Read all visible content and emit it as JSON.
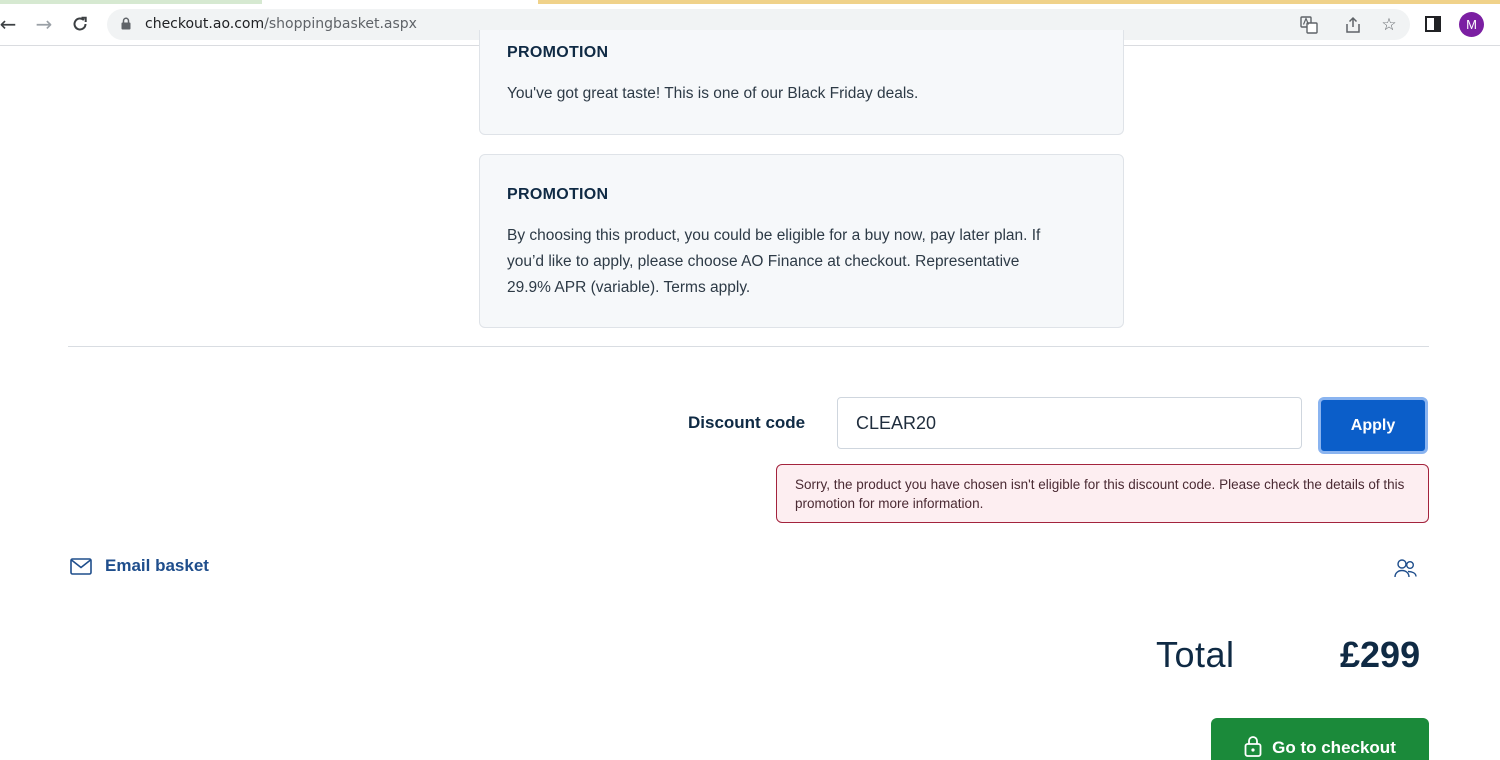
{
  "browser": {
    "url_host": "checkout.ao.com",
    "url_path": "/shoppingbasket.aspx",
    "profile_initial": "M",
    "icons": [
      "back-arrow-icon",
      "forward-arrow-icon",
      "reload-icon",
      "lock-icon",
      "translate-icon",
      "share-icon",
      "star-icon",
      "side-panel-icon"
    ]
  },
  "promotions": [
    {
      "title": "PROMOTION",
      "text": "You've got great taste! This is one of our Black Friday deals."
    },
    {
      "title": "PROMOTION",
      "text": "By choosing this product, you could be eligible for a buy now, pay later plan. If you’d like to apply, please choose AO Finance at checkout. Representative 29.9% APR (variable). Terms apply."
    }
  ],
  "discount": {
    "label": "Discount code",
    "value": "CLEAR20",
    "apply_label": "Apply",
    "error": "Sorry, the product you have chosen isn't eligible for this discount code. Please check the details of this promotion for more information."
  },
  "email_basket": {
    "label": "Email basket",
    "icon": "envelope-icon"
  },
  "total": {
    "label": "Total",
    "value": "£299"
  },
  "checkout": {
    "label": "Go to checkout",
    "icon": "padlock-icon"
  },
  "colors": {
    "primary_blue": "#0b5ec9",
    "checkout_green": "#1b8a3a",
    "error_border": "#a3233d",
    "error_bg": "#fdeef1",
    "navy_text": "#0f2a44"
  }
}
